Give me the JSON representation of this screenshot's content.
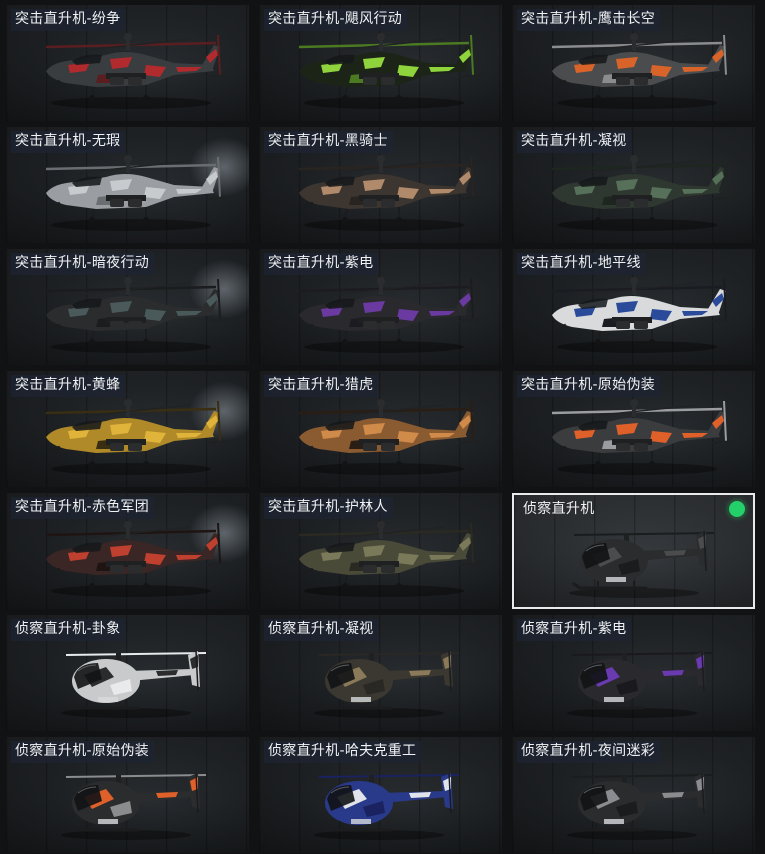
{
  "tiles": [
    {
      "label": "突击直升机-纷争",
      "kind": "attack",
      "colors": {
        "base": "#3a3d40",
        "accent": "#b02a2e",
        "accent2": "#5a1e20"
      },
      "selected": false
    },
    {
      "label": "突击直升机-飓风行动",
      "kind": "attack",
      "colors": {
        "base": "#1c2418",
        "accent": "#8fd43c",
        "accent2": "#4b7a22"
      },
      "selected": false
    },
    {
      "label": "突击直升机-鹰击长空",
      "kind": "attack",
      "colors": {
        "base": "#4a4c4e",
        "accent": "#d8642a",
        "accent2": "#8a8c8e"
      },
      "selected": false
    },
    {
      "label": "突击直升机-无瑕",
      "kind": "attack",
      "colors": {
        "base": "#9a9ea2",
        "accent": "#c8cbce",
        "accent2": "#6a6e72"
      },
      "selected": false
    },
    {
      "label": "突击直升机-黑骑士",
      "kind": "attack",
      "colors": {
        "base": "#3c3530",
        "accent": "#b08a6a",
        "accent2": "#2a2420"
      },
      "selected": false
    },
    {
      "label": "突击直升机-凝视",
      "kind": "attack",
      "colors": {
        "base": "#2e3830",
        "accent": "#56705a",
        "accent2": "#1e2620"
      },
      "selected": false
    },
    {
      "label": "突击直升机-暗夜行动",
      "kind": "attack",
      "colors": {
        "base": "#2a2c2e",
        "accent": "#4a5a5a",
        "accent2": "#1a1c1e"
      },
      "selected": false
    },
    {
      "label": "突击直升机-紫电",
      "kind": "attack",
      "colors": {
        "base": "#2a2a2e",
        "accent": "#6a3aa0",
        "accent2": "#1c1c20"
      },
      "selected": false
    },
    {
      "label": "突击直升机-地平线",
      "kind": "attack",
      "colors": {
        "base": "#d8dadc",
        "accent": "#2a4a9a",
        "accent2": "#1a1c22"
      },
      "selected": false
    },
    {
      "label": "突击直升机-黄蜂",
      "kind": "attack",
      "colors": {
        "base": "#b08a28",
        "accent": "#e0b43a",
        "accent2": "#3a2e12"
      },
      "selected": false
    },
    {
      "label": "突击直升机-猎虎",
      "kind": "attack",
      "colors": {
        "base": "#8a5a30",
        "accent": "#d08a4a",
        "accent2": "#2a1e14"
      },
      "selected": false
    },
    {
      "label": "突击直升机-原始伪装",
      "kind": "attack",
      "colors": {
        "base": "#3a3c3e",
        "accent": "#e0602a",
        "accent2": "#9a9ca0"
      },
      "selected": false
    },
    {
      "label": "突击直升机-赤色军团",
      "kind": "attack",
      "colors": {
        "base": "#3a2624",
        "accent": "#c04030",
        "accent2": "#1e1412"
      },
      "selected": false
    },
    {
      "label": "突击直升机-护林人",
      "kind": "attack",
      "colors": {
        "base": "#4a4a38",
        "accent": "#7a7a5a",
        "accent2": "#2a2a22"
      },
      "selected": false
    },
    {
      "label": "侦察直升机",
      "kind": "scout",
      "colors": {
        "base": "#2a2c2e",
        "accent": "#4a4c4e",
        "accent2": "#1a1c1e"
      },
      "selected": true
    },
    {
      "label": "侦察直升机-卦象",
      "kind": "scout",
      "colors": {
        "base": "#c8cacc",
        "accent": "#2a2c2e",
        "accent2": "#e8eaec"
      },
      "selected": false
    },
    {
      "label": "侦察直升机-凝视",
      "kind": "scout",
      "colors": {
        "base": "#3a3830",
        "accent": "#8a7a5a",
        "accent2": "#2a2824"
      },
      "selected": false
    },
    {
      "label": "侦察直升机-紫电",
      "kind": "scout",
      "colors": {
        "base": "#2a2a2e",
        "accent": "#6a3ab0",
        "accent2": "#1a1a1e"
      },
      "selected": false
    },
    {
      "label": "侦察直升机-原始伪装",
      "kind": "scout",
      "colors": {
        "base": "#2a2c2e",
        "accent": "#e0602a",
        "accent2": "#8a8c8e"
      },
      "selected": false
    },
    {
      "label": "侦察直升机-哈夫克重工",
      "kind": "scout",
      "colors": {
        "base": "#2a3a8a",
        "accent": "#e0e4ea",
        "accent2": "#1a2260"
      },
      "selected": false
    },
    {
      "label": "侦察直升机-夜间迷彩",
      "kind": "scout",
      "colors": {
        "base": "#2a2c2e",
        "accent": "#8a8c90",
        "accent2": "#1a1c1e"
      },
      "selected": false
    }
  ]
}
